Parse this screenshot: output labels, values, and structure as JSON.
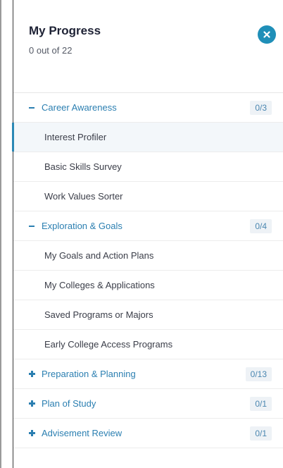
{
  "header": {
    "title": "My Progress",
    "subtitle": "0 out of 22",
    "close_icon": "close-icon"
  },
  "sections": [
    {
      "label": "Career Awareness",
      "count": "0/3",
      "expanded": true,
      "items": [
        {
          "label": "Interest Profiler",
          "active": true
        },
        {
          "label": "Basic Skills Survey",
          "active": false
        },
        {
          "label": "Work Values Sorter",
          "active": false
        }
      ]
    },
    {
      "label": "Exploration & Goals",
      "count": "0/4",
      "expanded": true,
      "items": [
        {
          "label": "My Goals and Action Plans",
          "active": false
        },
        {
          "label": "My Colleges & Applications",
          "active": false
        },
        {
          "label": "Saved Programs or Majors",
          "active": false
        },
        {
          "label": "Early College Access Programs",
          "active": false
        }
      ]
    },
    {
      "label": "Preparation & Planning",
      "count": "0/13",
      "expanded": false,
      "items": []
    },
    {
      "label": "Plan of Study",
      "count": "0/1",
      "expanded": false,
      "items": []
    },
    {
      "label": "Advisement Review",
      "count": "0/1",
      "expanded": false,
      "items": []
    }
  ],
  "colors": {
    "accent": "#2b7fb1",
    "close_bg": "#1f8fb8",
    "title": "#1e2235"
  }
}
